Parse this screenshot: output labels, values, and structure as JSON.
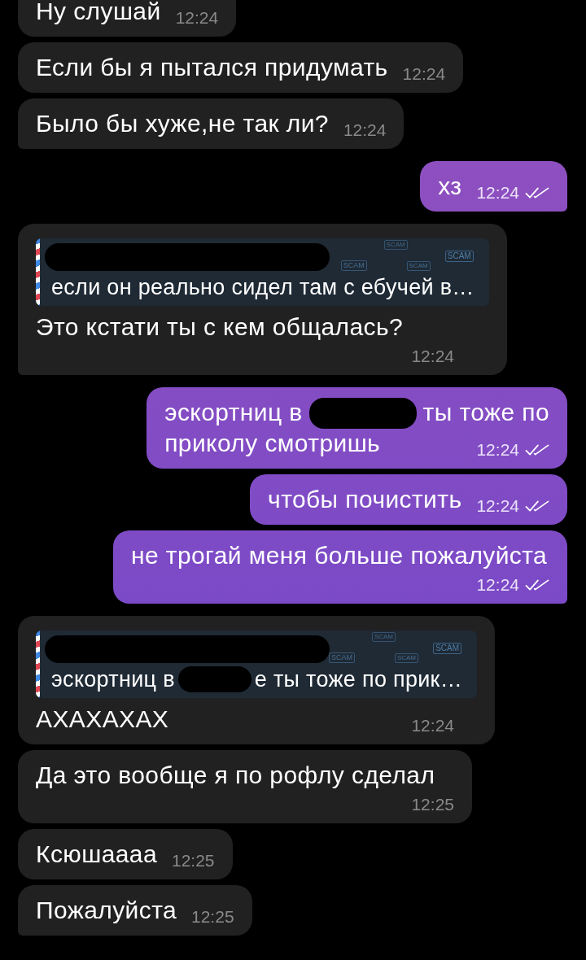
{
  "messages": [
    {
      "kind": "incoming",
      "text": "Ну слушай",
      "time": "12:24"
    },
    {
      "kind": "incoming",
      "text": "Если бы я пытался придумать",
      "time": "12:24"
    },
    {
      "kind": "incoming",
      "text": "Было бы хуже,не так ли?",
      "time": "12:24"
    },
    {
      "kind": "outgoing",
      "text": "хз",
      "time": "12:24",
      "read": true
    },
    {
      "kind": "incoming",
      "reply": {
        "author_redacted": true,
        "badges": [
          "SCAM",
          "SCAM",
          "SCAM",
          "SCAM"
        ],
        "parts": [
          {
            "kind": "text",
            "text": "если он реально сидел там с ебучей в…"
          }
        ]
      },
      "text": "Это кстати ты с кем общалась?",
      "time": "12:24"
    },
    {
      "kind": "outgoing",
      "lines": [
        [
          {
            "kind": "text",
            "text": "эскортниц в"
          },
          {
            "kind": "redaction"
          },
          {
            "kind": "text",
            "text": "ты тоже по"
          }
        ],
        [
          {
            "kind": "text",
            "text": "приколу смотришь"
          }
        ]
      ],
      "time": "12:24",
      "read": true
    },
    {
      "kind": "outgoing",
      "text": "чтобы почистить",
      "time": "12:24",
      "read": true
    },
    {
      "kind": "outgoing",
      "text": "не трогай меня больше пожалуйста",
      "time": "12:24",
      "read": true
    },
    {
      "kind": "incoming",
      "reply": {
        "author_redacted": true,
        "badges": [
          "SCAM",
          "SCAM",
          "SCAM",
          "SCAM"
        ],
        "parts": [
          {
            "kind": "text",
            "text": "эскортниц в"
          },
          {
            "kind": "redaction"
          },
          {
            "kind": "text",
            "text": "е ты тоже по прик…"
          }
        ]
      },
      "text": "АХАХАХАХ",
      "time": "12:24"
    },
    {
      "kind": "incoming",
      "text": "Да это вообще я по рофлу сделал",
      "time": "12:25"
    },
    {
      "kind": "incoming",
      "text": "Ксюшаааа",
      "time": "12:25"
    },
    {
      "kind": "incoming",
      "text": "Пожалуйста",
      "time": "12:25"
    }
  ]
}
